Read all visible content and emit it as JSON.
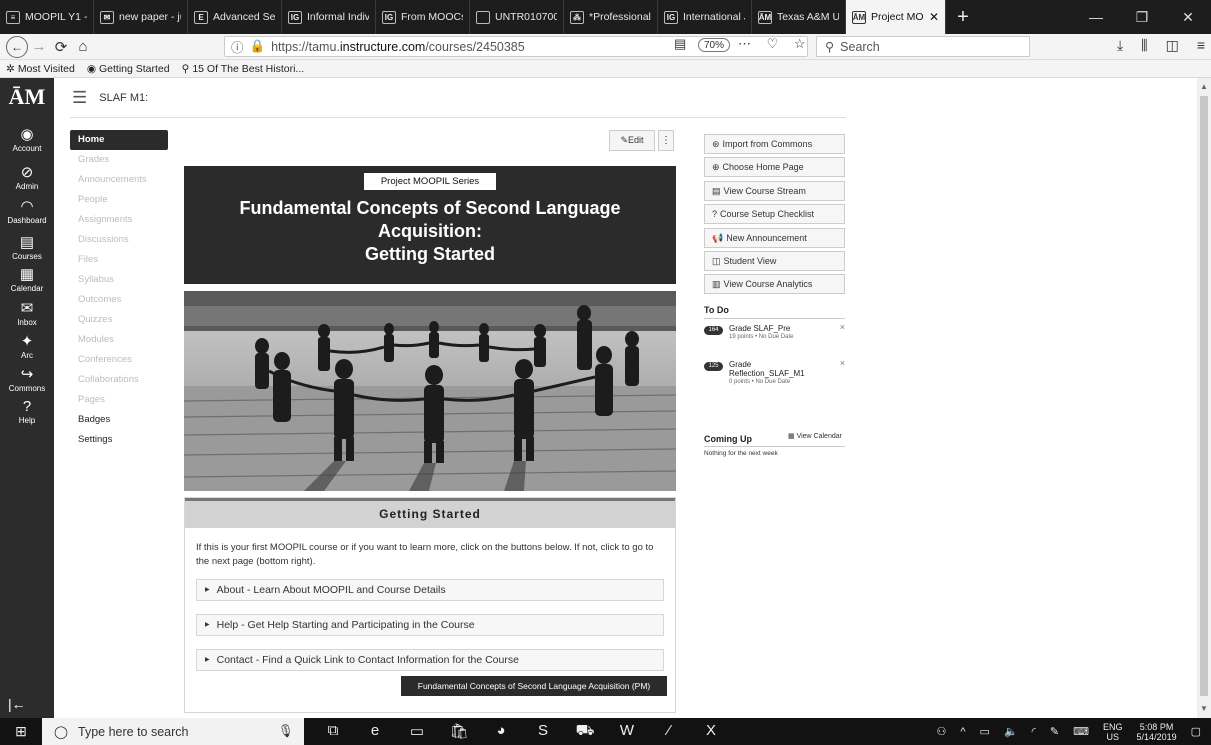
{
  "browser": {
    "tabs": [
      {
        "label": "MOOPIL Y1 - G",
        "icon": "sheets-icon",
        "glyph": "≡"
      },
      {
        "label": "new paper - jul",
        "icon": "mail-icon",
        "glyph": "✉"
      },
      {
        "label": "Advanced Sear",
        "icon": "search-engine-icon",
        "glyph": "E"
      },
      {
        "label": "Informal Indivic",
        "icon": "ig-icon",
        "glyph": "IG"
      },
      {
        "label": "From MOOCs t",
        "icon": "ig-icon",
        "glyph": "IG"
      },
      {
        "label": "UNTR01070028.pdf",
        "icon": "pdf-icon",
        "glyph": ""
      },
      {
        "label": "*Professional D",
        "icon": "translate-icon",
        "glyph": "⁂"
      },
      {
        "label": "International Jo",
        "icon": "ig-icon",
        "glyph": "IG"
      },
      {
        "label": "Texas A&M Un",
        "icon": "tamu-icon",
        "glyph": "ĀM"
      }
    ],
    "active_tab": {
      "label": "Project MO(",
      "icon": "tamu-icon",
      "glyph": "ĀM"
    },
    "url_prefix": "https://tamu.",
    "url_host": "instructure.com",
    "url_path": "/courses/2450385",
    "zoom": "70%",
    "search_placeholder": "Search",
    "bookmarks": [
      {
        "label": "Most Visited",
        "icon": "gear-icon",
        "glyph": "✲"
      },
      {
        "label": "Getting Started",
        "icon": "firefox-icon",
        "glyph": "◉"
      },
      {
        "label": "15 Of The Best Histori...",
        "icon": "pin-icon",
        "glyph": "⚲"
      }
    ]
  },
  "global_nav": {
    "logo": "ĀM",
    "items": [
      {
        "label": "Account",
        "glyph": "◉",
        "name": "account"
      },
      {
        "label": "Admin",
        "glyph": "⊘",
        "name": "admin"
      },
      {
        "label": "Dashboard",
        "glyph": "◠",
        "name": "dashboard"
      },
      {
        "label": "Courses",
        "glyph": "▤",
        "name": "courses"
      },
      {
        "label": "Calendar",
        "glyph": "▦",
        "name": "calendar"
      },
      {
        "label": "Inbox",
        "glyph": "✉",
        "name": "inbox"
      },
      {
        "label": "Arc",
        "glyph": "✦",
        "name": "arc"
      },
      {
        "label": "Commons",
        "glyph": "↪",
        "name": "commons"
      },
      {
        "label": "Help",
        "glyph": "?",
        "name": "help"
      }
    ],
    "collapse_glyph": "|←"
  },
  "course": {
    "breadcrumb": "SLAF M1:",
    "nav": [
      {
        "label": "Home",
        "state": "home"
      },
      {
        "label": "Grades",
        "state": "muted"
      },
      {
        "label": "Announcements",
        "state": "muted"
      },
      {
        "label": "People",
        "state": "muted"
      },
      {
        "label": "Assignments",
        "state": "muted"
      },
      {
        "label": "Discussions",
        "state": "muted"
      },
      {
        "label": "Files",
        "state": "muted"
      },
      {
        "label": "Syllabus",
        "state": "muted"
      },
      {
        "label": "Outcomes",
        "state": "muted"
      },
      {
        "label": "Quizzes",
        "state": "muted"
      },
      {
        "label": "Modules",
        "state": "muted"
      },
      {
        "label": "Conferences",
        "state": "muted"
      },
      {
        "label": "Collaborations",
        "state": "muted"
      },
      {
        "label": "Pages",
        "state": "muted"
      },
      {
        "label": "Badges",
        "state": "dark"
      },
      {
        "label": "Settings",
        "state": "dark"
      }
    ]
  },
  "content": {
    "edit_label": "Edit",
    "series_label": "Project MOOPIL Series",
    "title_lines": [
      "Fundamental Concepts of Second Language",
      "Acquisition:",
      "Getting Started"
    ],
    "section_title": "Getting Started",
    "intro": "If this is your first MOOPIL course or if you want to learn more, click on the buttons below. If not, click to go to the next page (bottom right).",
    "accordions": [
      "About - Learn About MOOPIL and Course Details",
      "Help - Get Help Starting and Participating in the Course",
      "Contact - Find a Quick Link to Contact Information for the Course"
    ],
    "next_page_label": "Fundamental Concepts of Second Language Acquisition (PM)"
  },
  "sidebar": {
    "buttons": [
      {
        "label": "Import from Commons",
        "glyph": "⊛"
      },
      {
        "label": "Choose Home Page",
        "glyph": "⊕"
      },
      {
        "label": "View Course Stream",
        "glyph": "▤"
      },
      {
        "label": "Course Setup Checklist",
        "glyph": "?"
      },
      {
        "label": "New Announcement",
        "glyph": "📢"
      },
      {
        "label": "Student View",
        "glyph": "◫"
      },
      {
        "label": "View Course Analytics",
        "glyph": "▥"
      }
    ],
    "todo_title": "To Do",
    "todo": [
      {
        "badge": "164",
        "title": "Grade SLAF_Pre",
        "meta": "19 points • No Due Date"
      },
      {
        "badge": "125",
        "title": "Grade Reflection_SLAF_M1",
        "meta": "0 points • No Due Date"
      }
    ],
    "coming_up_title": "Coming Up",
    "view_calendar": "View Calendar",
    "coming_up_empty": "Nothing for the next week"
  },
  "taskbar": {
    "search_placeholder": "Type here to search",
    "apps": [
      "⧉",
      "e",
      "▭",
      "🛍",
      "◕",
      "S",
      "⛟",
      "W",
      "⁄",
      "X"
    ],
    "lang_top": "ENG",
    "lang_bottom": "US",
    "time": "5:08 PM",
    "date": "5/14/2019"
  }
}
